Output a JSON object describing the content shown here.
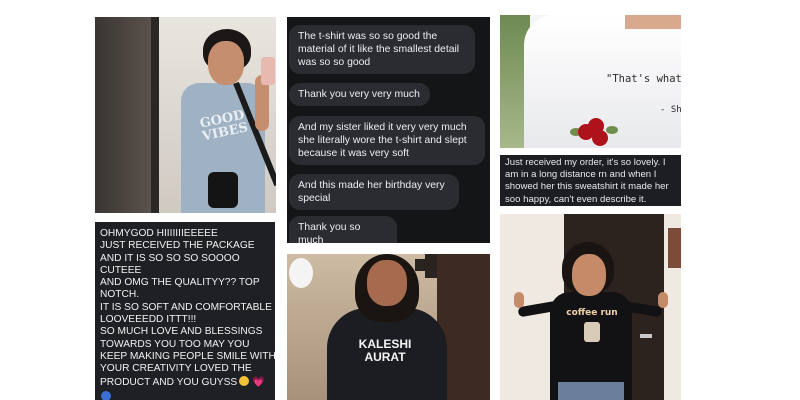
{
  "tiles": {
    "selfie_photo": {
      "shirt_print": "GOOD VIBES"
    },
    "chat": {
      "messages": [
        "The t-shirt was so so good the material of it like the smallest detail was so so good",
        "Thank you very very much",
        "And my sister liked it very very much she literally wore the t-shirt and slept because it was very soft",
        "And this made her birthday very special",
        "Thank you so much"
      ]
    },
    "sweatshirt_photo": {
      "quote": "\"That's what",
      "signature": "- She"
    },
    "sweatshirt_caption": "Just received my order, it's so lovely. I am in a long distance rn and when I showed her this sweatshirt it made her soo happy, can't even describe it.",
    "text_review": {
      "lines": [
        "OHMYGOD HIIIIIIIEEEEE",
        "JUST RECEIVED THE PACKAGE",
        "AND IT IS SO SO SO SOOOO",
        "CUTEEE",
        "AND OMG THE QUALITYY?? TOP",
        "NOTCH.",
        "IT IS SO SOFT AND COMFORTABLE",
        "LOOVEEEDD ITTT!!!",
        "SO MUCH LOVE AND BLESSINGS",
        "TOWARDS YOU TOO MAY YOU",
        "KEEP MAKING PEOPLE SMILE WITH",
        "YOUR CREATIVITY LOVED THE",
        "PRODUCT AND YOU GUYSS"
      ],
      "emoji_heart": "💗"
    },
    "hoodie_photo": {
      "print_line1": "KALESHI",
      "print_line2": "AURAT"
    },
    "coffee_photo": {
      "print": "coffee run"
    }
  }
}
